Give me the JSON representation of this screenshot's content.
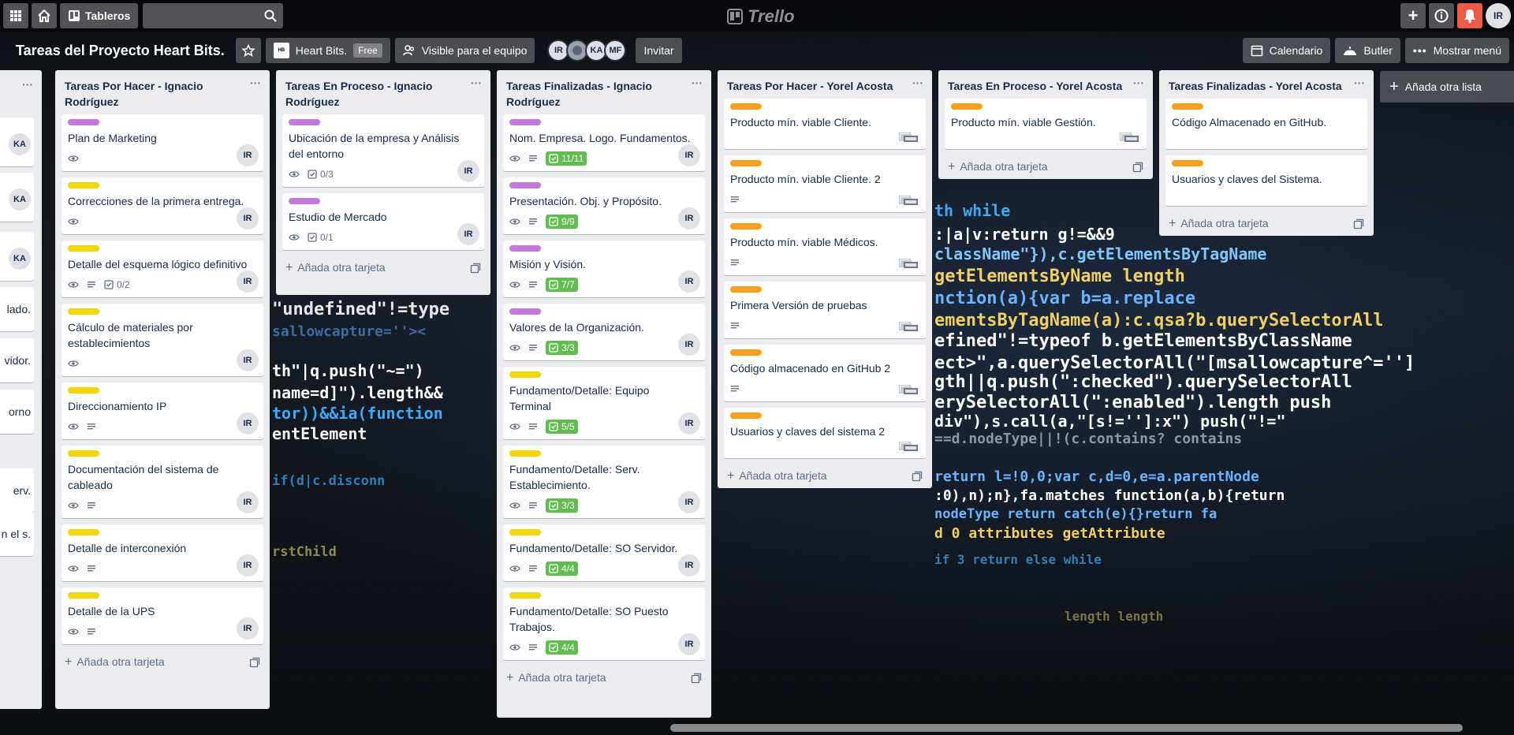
{
  "topbar": {
    "boards_label": "Tableros",
    "logo_text": "Trello",
    "user_initials": "IR"
  },
  "board": {
    "title": "Tareas del Proyecto Heart Bits.",
    "workspace": "Heart Bits.",
    "workspace_badge": "Free",
    "visibility": "Visible para el equipo",
    "members": [
      "IR",
      "",
      "KA",
      "MF"
    ],
    "invite": "Invitar",
    "calendar": "Calendario",
    "butler": "Butler",
    "menu": "Mostrar menú"
  },
  "add_list": "Añada otra lista",
  "add_card": "Añada otra tarjeta",
  "partial_list": {
    "snippets": [
      "KA",
      "KA",
      "KA",
      "lado.",
      "vidor.",
      "orno",
      "erv.",
      "n el s."
    ]
  },
  "lists": [
    {
      "title": "Tareas Por Hacer - Ignacio Rodríguez",
      "cards": [
        {
          "label": "#c377e0",
          "title": "Plan de Marketing",
          "watch": true,
          "desc": false,
          "check": "",
          "avatar": "IR"
        },
        {
          "label": "#f2d600",
          "title": "Correcciones de la primera entrega.",
          "watch": true,
          "desc": false,
          "check": "",
          "avatar": "IR"
        },
        {
          "label": "#f2d600",
          "title": "Detalle del esquema lógico definitivo",
          "watch": true,
          "desc": true,
          "check": "0/2",
          "avatar": "IR"
        },
        {
          "label": "#f2d600",
          "title": "Cálculo de materiales por establecimientos",
          "watch": true,
          "desc": false,
          "check": "",
          "avatar": "IR"
        },
        {
          "label": "#f2d600",
          "title": "Direccionamiento IP",
          "watch": true,
          "desc": true,
          "check": "",
          "avatar": "IR"
        },
        {
          "label": "#f2d600",
          "title": "Documentación del sistema de cableado",
          "watch": true,
          "desc": true,
          "check": "",
          "avatar": "IR"
        },
        {
          "label": "#f2d600",
          "title": "Detalle de interconexión",
          "watch": true,
          "desc": true,
          "check": "",
          "avatar": "IR"
        },
        {
          "label": "#f2d600",
          "title": "Detalle de la UPS",
          "watch": true,
          "desc": true,
          "check": "",
          "avatar": "IR"
        }
      ]
    },
    {
      "title": "Tareas En Proceso - Ignacio Rodríguez",
      "cards": [
        {
          "label": "#c377e0",
          "title": "Ubicación de la empresa y Análisis del entorno",
          "watch": true,
          "desc": false,
          "check": "0/3",
          "avatar": "IR"
        },
        {
          "label": "#c377e0",
          "title": "Estudio de Mercado",
          "watch": true,
          "desc": false,
          "check": "0/1",
          "avatar": "IR"
        }
      ]
    },
    {
      "title": "Tareas Finalizadas - Ignacio Rodríguez",
      "cards": [
        {
          "label": "#c377e0",
          "title": "Nom. Empresa. Logo. Fundamentos.",
          "watch": true,
          "desc": true,
          "done": "11/11",
          "avatar": "IR"
        },
        {
          "label": "#c377e0",
          "title": "Presentación. Obj. y Propósito.",
          "watch": true,
          "desc": true,
          "done": "9/9",
          "avatar": "IR"
        },
        {
          "label": "#c377e0",
          "title": "Misión y Visión.",
          "watch": true,
          "desc": true,
          "done": "7/7",
          "avatar": "IR"
        },
        {
          "label": "#c377e0",
          "title": "Valores de la Organización.",
          "watch": true,
          "desc": true,
          "done": "3/3",
          "avatar": "IR"
        },
        {
          "label": "#f2d600",
          "title": "Fundamento/Detalle: Equipo Terminal",
          "watch": true,
          "desc": true,
          "done": "5/5",
          "avatar": "IR"
        },
        {
          "label": "#f2d600",
          "title": "Fundamento/Detalle: Serv. Establecimiento.",
          "watch": true,
          "desc": true,
          "done": "3/3",
          "avatar": "IR"
        },
        {
          "label": "#f2d600",
          "title": "Fundamento/Detalle: SO Servidor.",
          "watch": true,
          "desc": true,
          "done": "4/4",
          "avatar": "IR"
        },
        {
          "label": "#f2d600",
          "title": "Fundamento/Detalle: SO Puesto Trabajos.",
          "watch": true,
          "desc": true,
          "done": "4/4",
          "avatar": "IR"
        }
      ]
    },
    {
      "title": "Tareas Por Hacer - Yorel Acosta",
      "cards": [
        {
          "label": "#ff9f1a",
          "title": "Producto mín. viable Cliente.",
          "desc": false
        },
        {
          "label": "#ff9f1a",
          "title": "Producto mín. viable Cliente. 2",
          "desc": true
        },
        {
          "label": "#ff9f1a",
          "title": "Producto mín. viable Médicos.",
          "desc": true
        },
        {
          "label": "#ff9f1a",
          "title": "Primera Versión de pruebas",
          "desc": true
        },
        {
          "label": "#ff9f1a",
          "title": "Código almacenado en GitHub 2",
          "desc": true
        },
        {
          "label": "#ff9f1a",
          "title": "Usuarios y claves del sistema 2",
          "desc": false
        }
      ]
    },
    {
      "title": "Tareas En Proceso - Yorel Acosta",
      "cards": [
        {
          "label": "#ff9f1a",
          "title": "Producto mín. viable Gestión.",
          "desc": false
        }
      ]
    },
    {
      "title": "Tareas Finalizadas - Yorel Acosta",
      "cards": [
        {
          "label": "#ff9f1a",
          "title": "Código Almacenado en GitHub.",
          "desc": false
        },
        {
          "label": "#ff9f1a",
          "title": "Usuarios y claves del Sistema.",
          "desc": false
        }
      ]
    }
  ]
}
